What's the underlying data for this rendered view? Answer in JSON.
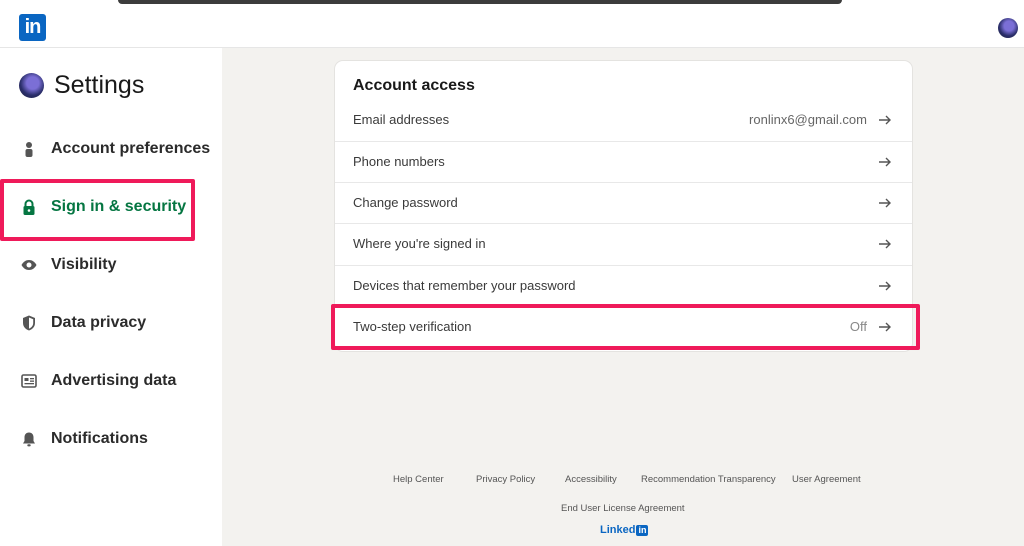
{
  "header": {
    "logo_text": "in",
    "avatar_icon": "user-avatar"
  },
  "sidebar": {
    "title": "Settings",
    "items": [
      {
        "label": "Account preferences",
        "icon": "person-icon"
      },
      {
        "label": "Sign in & security",
        "icon": "lock-icon",
        "active": true
      },
      {
        "label": "Visibility",
        "icon": "eye-icon"
      },
      {
        "label": "Data privacy",
        "icon": "shield-icon"
      },
      {
        "label": "Advertising data",
        "icon": "newspaper-icon"
      },
      {
        "label": "Notifications",
        "icon": "bell-icon"
      }
    ]
  },
  "account_access": {
    "title": "Account access",
    "rows": [
      {
        "label": "Email addresses",
        "value": "ronlinx6@gmail.com"
      },
      {
        "label": "Phone numbers",
        "value": ""
      },
      {
        "label": "Change password",
        "value": ""
      },
      {
        "label": "Where you're signed in",
        "value": ""
      },
      {
        "label": "Devices that remember your password",
        "value": ""
      },
      {
        "label": "Two-step verification",
        "value": "Off"
      }
    ]
  },
  "footer": {
    "links": [
      "Help Center",
      "Privacy Policy",
      "Accessibility",
      "Recommendation Transparency",
      "User Agreement",
      "End User License Agreement"
    ],
    "brand_text": "Linked",
    "brand_box": "in"
  },
  "colors": {
    "accent": "#0a66c2",
    "active": "#057642",
    "highlight": "#ef1a5a"
  }
}
